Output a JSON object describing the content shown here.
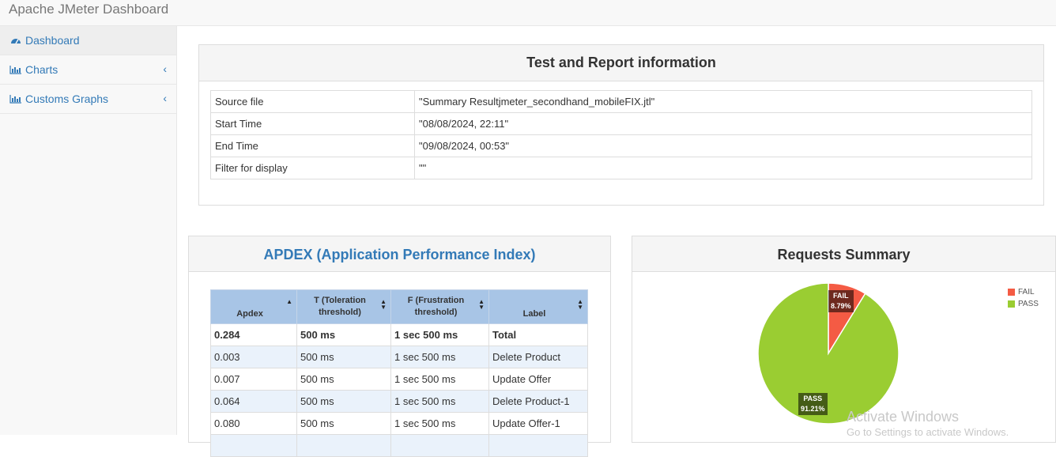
{
  "app": {
    "title": "Apache JMeter Dashboard"
  },
  "sidebar": {
    "items": [
      {
        "label": "Dashboard",
        "icon": "dashboard-icon"
      },
      {
        "label": "Charts",
        "icon": "bar-chart-icon"
      },
      {
        "label": "Customs Graphs",
        "icon": "bar-chart-icon"
      }
    ]
  },
  "report_info": {
    "title": "Test and Report information",
    "rows": [
      {
        "key": "Source file",
        "value": "\"Summary Resultjmeter_secondhand_mobileFIX.jtl\""
      },
      {
        "key": "Start Time",
        "value": "\"08/08/2024, 22:11\""
      },
      {
        "key": "End Time",
        "value": "\"09/08/2024, 00:53\""
      },
      {
        "key": "Filter for display",
        "value": "\"\""
      }
    ]
  },
  "apdex": {
    "title": "APDEX (Application Performance Index)",
    "headers": [
      "Apdex",
      "T (Toleration threshold)",
      "F (Frustration threshold)",
      "Label"
    ],
    "rows": [
      [
        "0.284",
        "500 ms",
        "1 sec 500 ms",
        "Total"
      ],
      [
        "0.003",
        "500 ms",
        "1 sec 500 ms",
        "Delete Product"
      ],
      [
        "0.007",
        "500 ms",
        "1 sec 500 ms",
        "Update Offer"
      ],
      [
        "0.064",
        "500 ms",
        "1 sec 500 ms",
        "Delete Product-1"
      ],
      [
        "0.080",
        "500 ms",
        "1 sec 500 ms",
        "Update Offer-1"
      ]
    ]
  },
  "requests_summary": {
    "title": "Requests Summary",
    "legend": [
      {
        "name": "FAIL",
        "color": "#f45b44"
      },
      {
        "name": "PASS",
        "color": "#9acd32"
      }
    ],
    "labels": {
      "fail_name": "FAIL",
      "fail_pct": "8.79%",
      "pass_name": "PASS",
      "pass_pct": "91.21%"
    }
  },
  "chart_data": {
    "type": "pie",
    "title": "Requests Summary",
    "categories": [
      "FAIL",
      "PASS"
    ],
    "values": [
      8.79,
      91.21
    ],
    "colors": [
      "#f45b44",
      "#9acd32"
    ],
    "legend_position": "top-right"
  },
  "watermark": {
    "line1": "Activate Windows",
    "line2": "Go to Settings to activate Windows."
  }
}
